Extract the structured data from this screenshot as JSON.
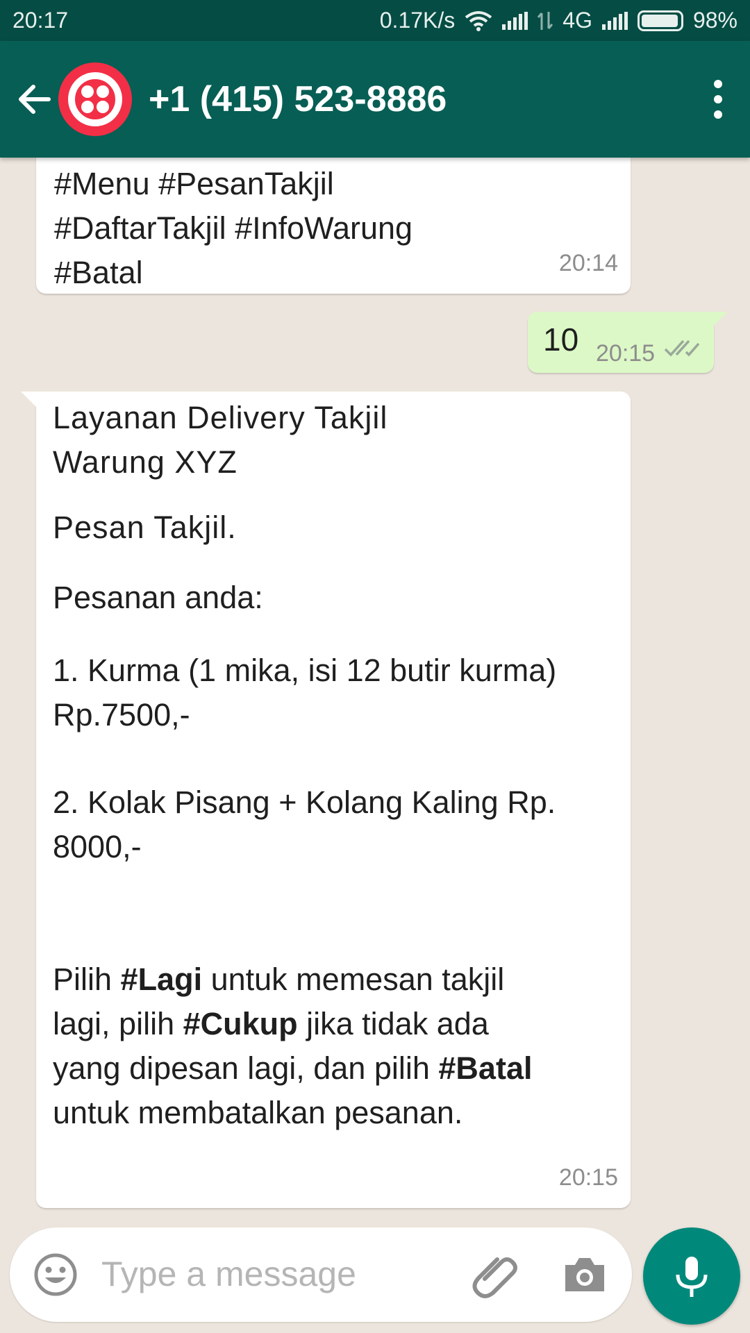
{
  "status_bar": {
    "time": "20:17",
    "net_speed": "0.17K/s",
    "network": "4G",
    "battery": "98%"
  },
  "header": {
    "contact_title": "+1 (415) 523-8886",
    "avatar_color": "#f22f46",
    "bar_color": "#075e54"
  },
  "messages": [
    {
      "direction": "incoming",
      "lines": [
        "#Menu #PesanTakjil",
        "#DaftarTakjil #InfoWarung",
        "#Batal"
      ],
      "time": "20:14"
    },
    {
      "direction": "outgoing",
      "text": "10",
      "time": "20:15",
      "status": "delivered"
    },
    {
      "direction": "incoming",
      "title_lines": [
        "Layanan  Delivery  Takjil",
        "Warung  XYZ"
      ],
      "subtitle": "Pesan  Takjil.",
      "orders_label": "Pesanan anda:",
      "item1_lines": [
        "1. Kurma (1 mika, isi 12 butir kurma)",
        "Rp.7500,-"
      ],
      "item2_lines": [
        "2. Kolak Pisang + Kolang Kaling Rp.",
        "8000,-"
      ],
      "footer": {
        "l1_a": "Pilih ",
        "l1_b": "#Lagi",
        "l1_c": " untuk memesan takjil",
        "l2_a": "lagi, pilih ",
        "l2_b": "#Cukup",
        "l2_c": " jika tidak ada",
        "l3_a": "yang dipesan lagi, dan pilih ",
        "l3_b": "#Batal",
        "l4": "untuk membatalkan pesanan."
      },
      "time": "20:15"
    }
  ],
  "composer": {
    "placeholder": "Type a message",
    "accent": "#00897b"
  }
}
